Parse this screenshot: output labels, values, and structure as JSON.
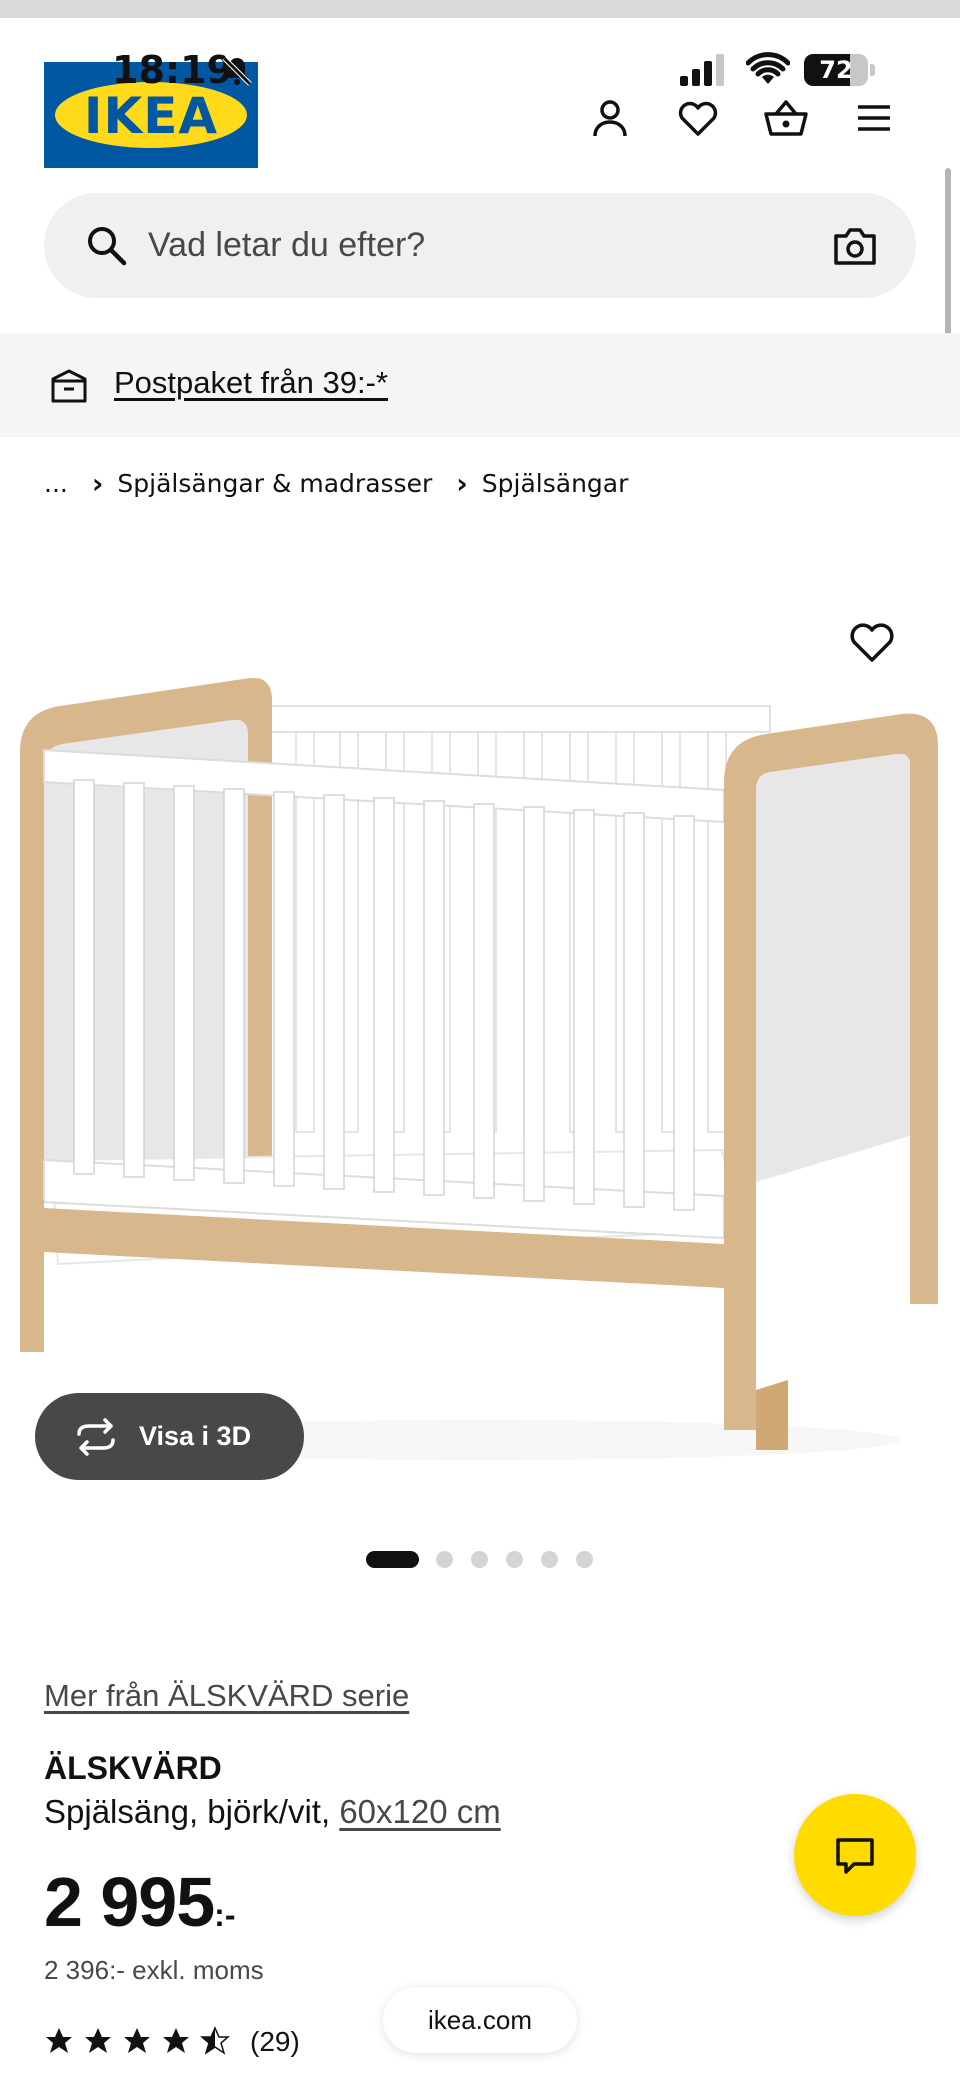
{
  "status_bar": {
    "time": "18:19",
    "battery_level": "72",
    "battery_fraction": 0.72,
    "icons": [
      "bell-muted-icon",
      "signal-icon",
      "wifi-icon",
      "battery-icon"
    ]
  },
  "header": {
    "logo_text": "IKEA",
    "icons": [
      "user-icon",
      "heart-icon",
      "basket-icon",
      "menu-icon"
    ]
  },
  "search": {
    "placeholder": "Vad letar du efter?",
    "icons": [
      "search-icon",
      "camera-icon"
    ]
  },
  "promo": {
    "text": "Postpaket från 39:-*",
    "icon": "delivery-box-icon"
  },
  "breadcrumb": [
    "...",
    "Spjälsängar & madrasser",
    "Spjälsängar"
  ],
  "gallery": {
    "view_3d_label": "Visa i 3D",
    "total_images": 6,
    "active_index": 0
  },
  "product": {
    "series_link": "Mer från ÄLSKVÄRD serie",
    "name": "ÄLSKVÄRD",
    "description": "Spjälsäng, björk/vit,",
    "size": "60x120 cm",
    "price": "2 995",
    "price_suffix": ":-",
    "price_ex_vat": "2 396:- exkl. moms",
    "rating": 4.5,
    "rating_max": 5,
    "review_count": "(29)"
  },
  "browser": {
    "url": "ikea.com"
  },
  "colors": {
    "ikea_blue": "#0058a3",
    "ikea_yellow": "#ffda1a",
    "chat_yellow": "#ffdb00",
    "pill_grey": "#484848"
  }
}
